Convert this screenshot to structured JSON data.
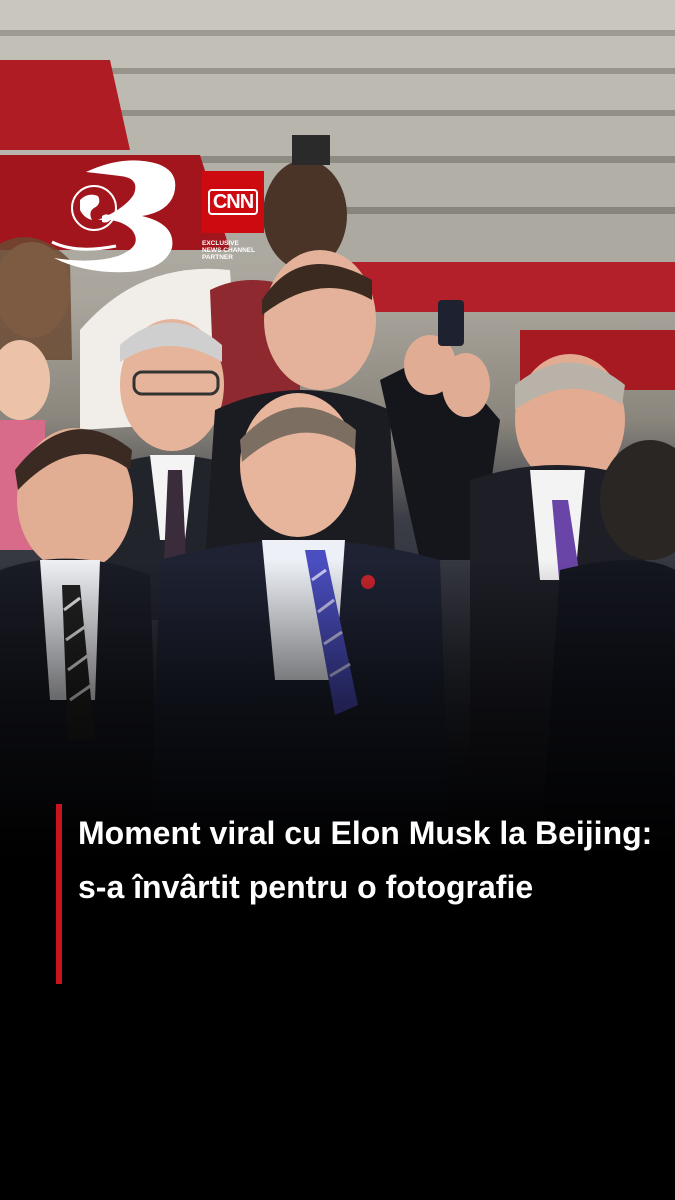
{
  "channel": {
    "logo_icon": "channel-3-globe-logo",
    "partner_badge": "CNN",
    "partner_text": "EXCLUSIVE\nNEWS CHANNEL\nPARTNER",
    "brand_color": "#cc0a0f"
  },
  "story": {
    "headline": "Moment viral cu Elon Musk la Beijing: s-a învârtit pentru o fotografie",
    "accent_color": "#c8141e"
  }
}
